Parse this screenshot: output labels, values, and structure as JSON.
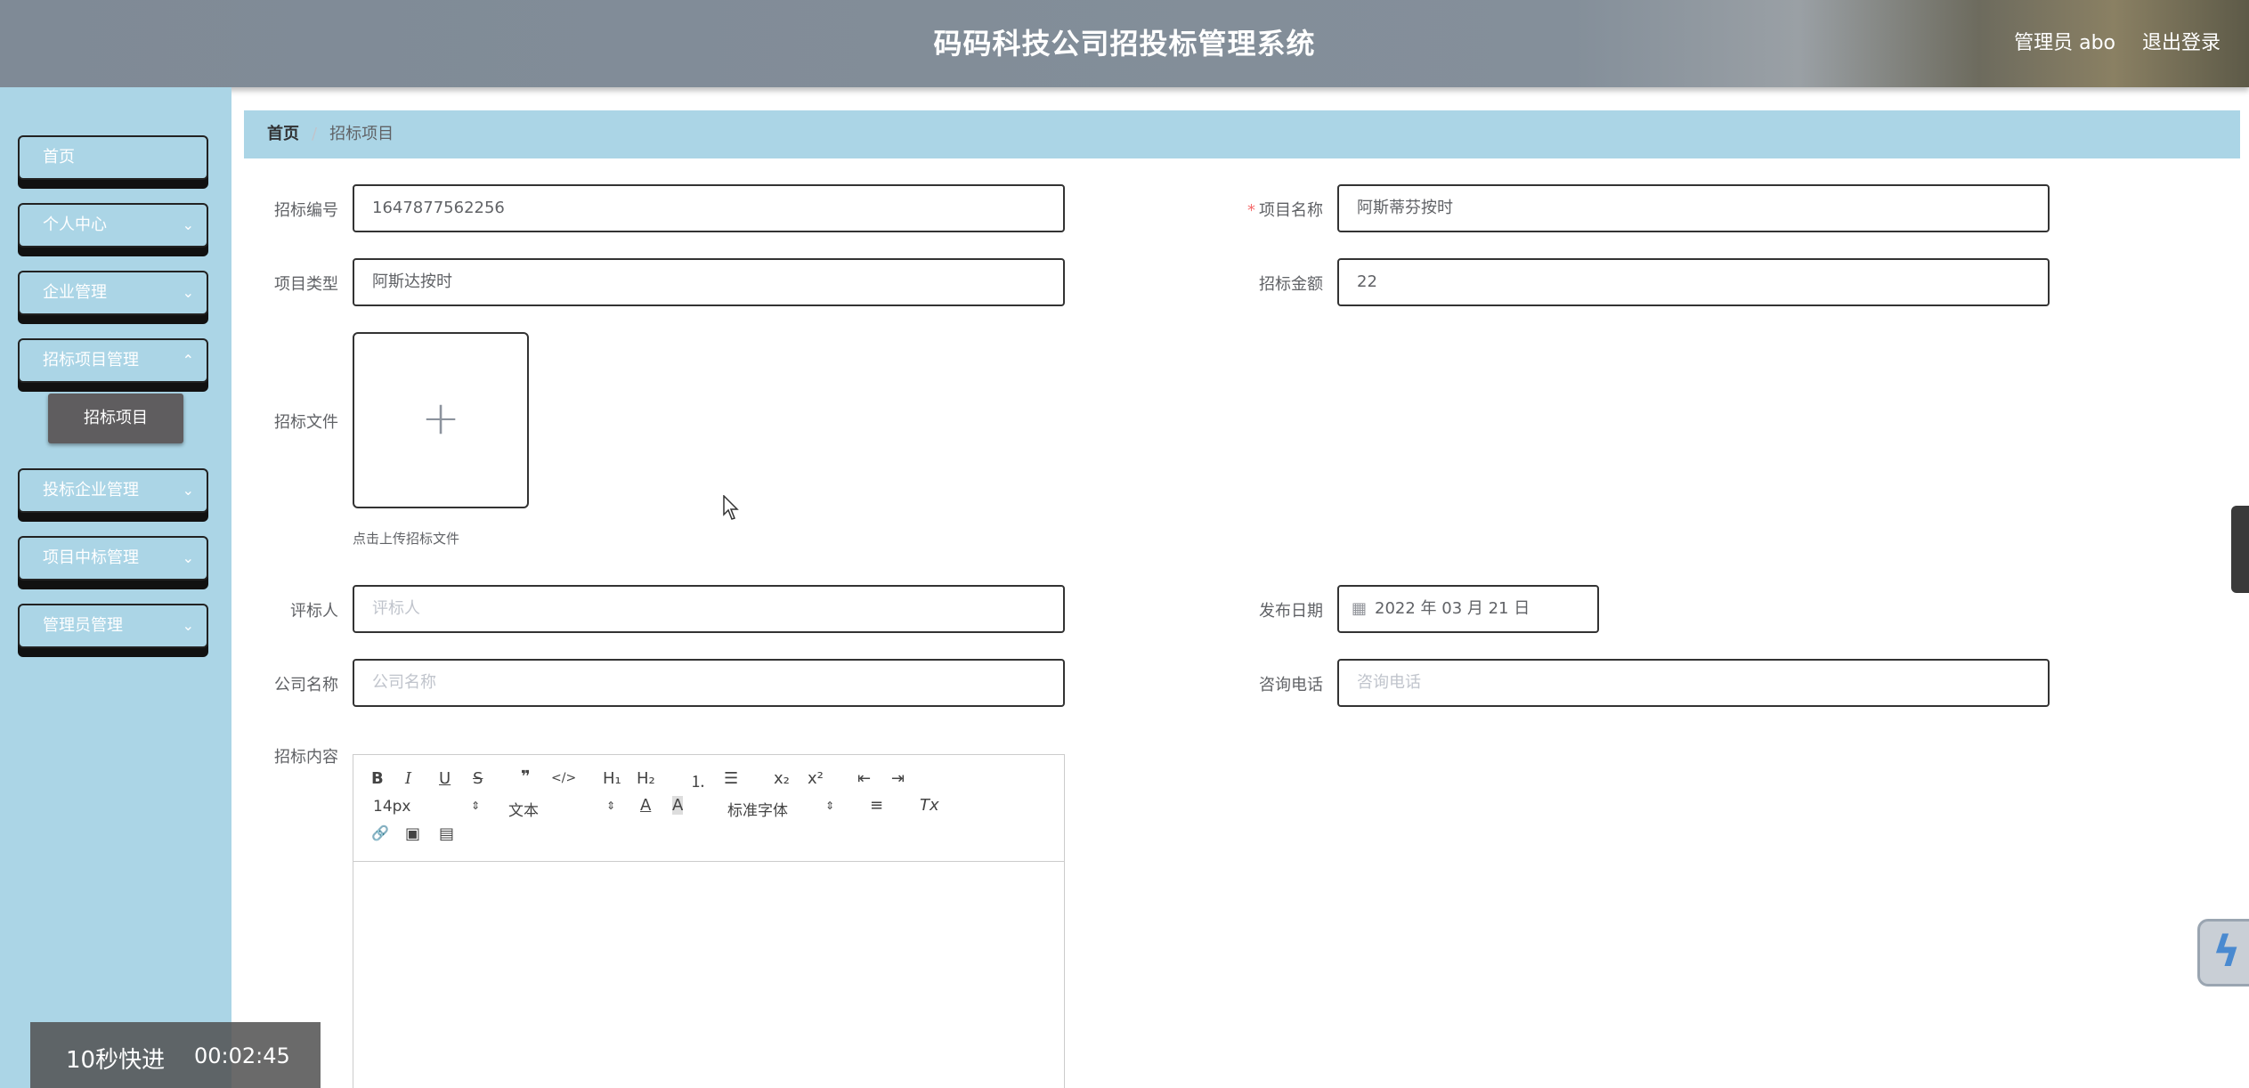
{
  "header": {
    "title": "码码科技公司招投标管理系统",
    "user": "管理员 abo",
    "logout": "退出登录"
  },
  "sidebar": {
    "items": [
      {
        "label": "首页",
        "expandable": false
      },
      {
        "label": "个人中心",
        "expandable": true
      },
      {
        "label": "企业管理",
        "expandable": true
      },
      {
        "label": "招标项目管理",
        "expandable": true
      },
      {
        "label": "投标企业管理",
        "expandable": true
      },
      {
        "label": "项目中标管理",
        "expandable": true
      },
      {
        "label": "管理员管理",
        "expandable": true
      }
    ],
    "active_subitem": "招标项目"
  },
  "breadcrumb": {
    "home": "首页",
    "separator": "/",
    "current": "招标项目"
  },
  "form": {
    "bid_number": {
      "label": "招标编号",
      "value": "1647877562256"
    },
    "project_name": {
      "label": "项目名称",
      "value": "阿斯蒂芬按时",
      "required_mark": "*"
    },
    "project_type": {
      "label": "项目类型",
      "value": "阿斯达按时"
    },
    "bid_amount": {
      "label": "招标金额",
      "value": "22"
    },
    "bid_file": {
      "label": "招标文件",
      "tip": "点击上传招标文件"
    },
    "reviewer": {
      "label": "评标人",
      "placeholder": "评标人"
    },
    "publish_date": {
      "label": "发布日期",
      "value": "2022 年 03 月 21 日"
    },
    "company_name": {
      "label": "公司名称",
      "placeholder": "公司名称"
    },
    "phone": {
      "label": "咨询电话",
      "placeholder": "咨询电话"
    },
    "content": {
      "label": "招标内容"
    }
  },
  "editor": {
    "font_size": "14px",
    "header_select": "文本",
    "font_family": "标准字体",
    "buttons": {
      "bold": "B",
      "italic": "I",
      "underline": "U",
      "strike": "S",
      "quote": "❞",
      "code": "</>",
      "h1": "H₁",
      "h2": "H₂",
      "ordered_list": "⒈",
      "bullet_list": "☰",
      "sub": "x₂",
      "sup": "x²",
      "indent_less": "⇤",
      "indent_more": "⇥",
      "color": "A",
      "background": "A",
      "align": "≡",
      "clean": "Tx",
      "link": "🔗",
      "image": "▣",
      "video": "▤"
    }
  },
  "video_overlay": {
    "fast_forward": "10秒快进",
    "time": "00:02:45"
  }
}
